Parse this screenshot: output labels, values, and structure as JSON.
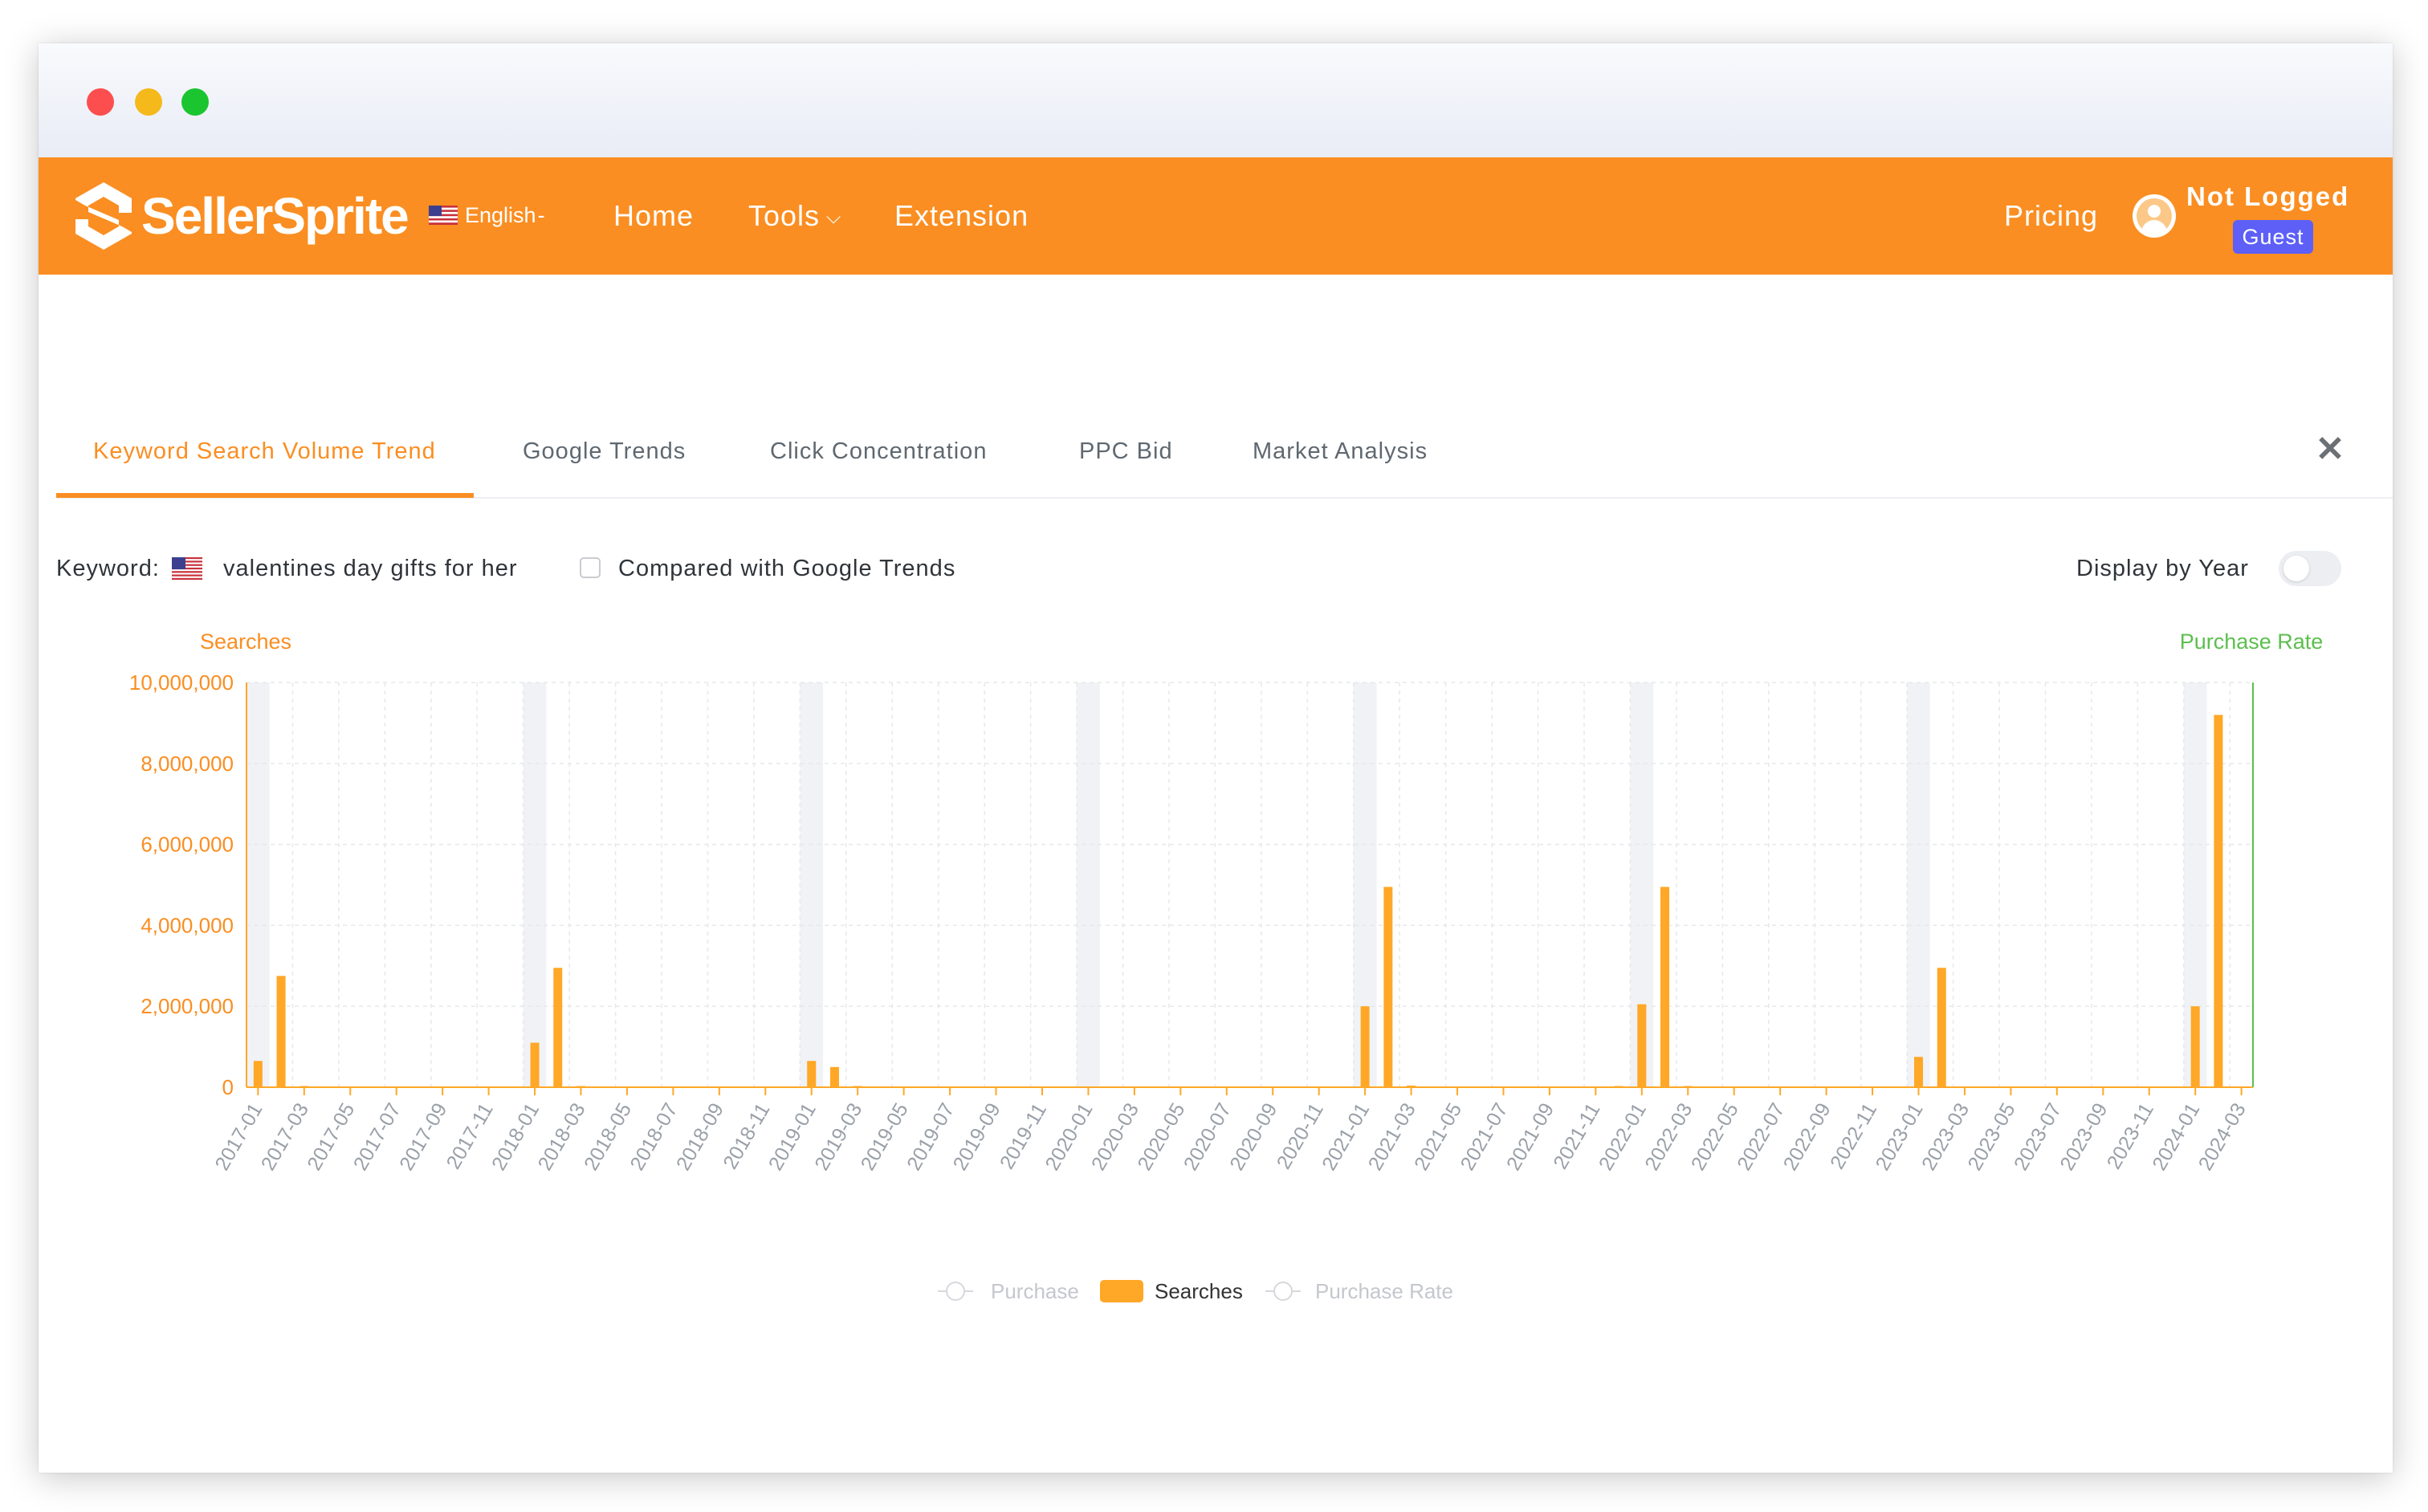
{
  "nav": {
    "brand": "SellerSprite",
    "language": "English",
    "links": {
      "home": "Home",
      "tools": "Tools",
      "extension": "Extension",
      "pricing": "Pricing"
    },
    "user": {
      "name": "Not Logged",
      "badge": "Guest"
    }
  },
  "tabs": [
    "Keyword Search Volume Trend",
    "Google Trends",
    "Click Concentration",
    "PPC Bid",
    "Market Analysis"
  ],
  "active_tab": "Keyword Search Volume Trend",
  "filters": {
    "keyword_label": "Keyword:",
    "keyword_value": "valentines day gifts for her",
    "compare_label": "Compared with Google Trends",
    "compare_checked": false,
    "display_by_year_label": "Display by Year",
    "display_by_year_on": false
  },
  "colors": {
    "brand_orange": "#fa8e22",
    "bar_color": "#ffa726",
    "purchase_rate_color": "#5cbf4e",
    "guest_badge": "#5d5ff7"
  },
  "chart_data": {
    "type": "bar",
    "title": "",
    "ylabel_left": "Searches",
    "ylabel_right": "Purchase Rate",
    "ylim": [
      0,
      10000000
    ],
    "y_ticks": [
      "10,000,000",
      "8,000,000",
      "6,000,000",
      "4,000,000",
      "2,000,000",
      "0"
    ],
    "x_start": "2017-01",
    "x_end": "2024-03",
    "x_tick_labels": [
      "2017-01",
      "2017-03",
      "2017-05",
      "2017-07",
      "2017-09",
      "2017-11",
      "2018-01",
      "2018-03",
      "2018-05",
      "2018-07",
      "2018-09",
      "2018-11",
      "2019-01",
      "2019-03",
      "2019-05",
      "2019-07",
      "2019-09",
      "2019-11",
      "2020-01",
      "2020-03",
      "2020-05",
      "2020-07",
      "2020-09",
      "2020-11",
      "2021-01",
      "2021-03",
      "2021-05",
      "2021-07",
      "2021-09",
      "2021-11",
      "2022-01",
      "2022-03",
      "2022-05",
      "2022-07",
      "2022-09",
      "2022-11",
      "2023-01",
      "2023-03",
      "2023-05",
      "2023-07",
      "2023-09",
      "2023-11",
      "2024-01",
      "2024-03"
    ],
    "highlighted_months": [
      "2017-01",
      "2018-01",
      "2019-01",
      "2020-01",
      "2021-01",
      "2022-01",
      "2023-01",
      "2024-01"
    ],
    "grid": true,
    "legend_position": "bottom-center",
    "legend": [
      {
        "name": "Purchase",
        "active": false
      },
      {
        "name": "Searches",
        "active": true
      },
      {
        "name": "Purchase Rate",
        "active": false
      }
    ],
    "series": [
      {
        "name": "Searches",
        "values": {
          "2017-01": 650000,
          "2017-02": 2750000,
          "2017-03": 30000,
          "2017-12": 20000,
          "2018-01": 1100000,
          "2018-02": 2950000,
          "2018-03": 30000,
          "2019-01": 650000,
          "2019-02": 500000,
          "2019-03": 30000,
          "2020-02": 15000,
          "2020-12": 20000,
          "2021-01": 2000000,
          "2021-02": 4950000,
          "2021-03": 40000,
          "2021-04": 15000,
          "2021-12": 30000,
          "2022-01": 2050000,
          "2022-02": 4950000,
          "2022-03": 30000,
          "2022-04": 15000,
          "2023-01": 750000,
          "2023-02": 2950000,
          "2023-03": 20000,
          "2023-12": 20000,
          "2024-01": 2000000,
          "2024-02": 9200000
        }
      }
    ]
  }
}
